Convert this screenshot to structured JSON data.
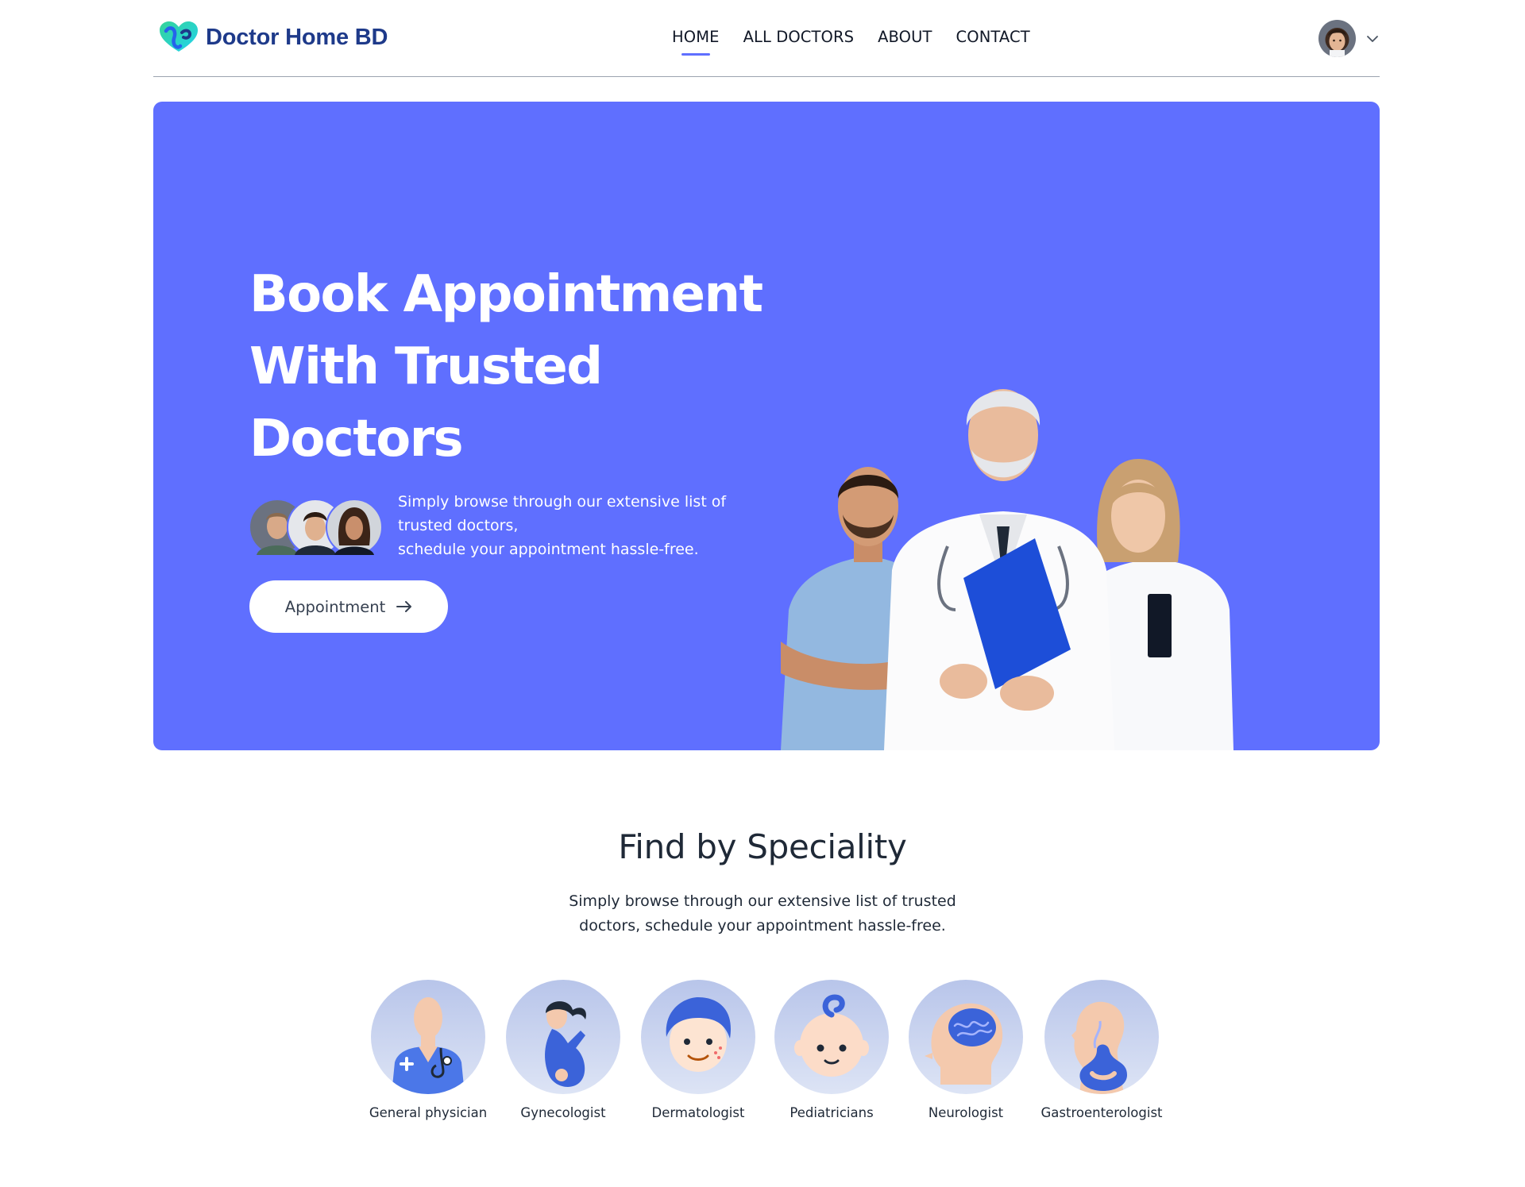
{
  "brand": {
    "name": "Doctor Home BD",
    "accent": "#5f6fff",
    "brand_text_color": "#1e3a8a"
  },
  "nav": {
    "links": [
      "HOME",
      "ALL DOCTORS",
      "ABOUT",
      "CONTACT"
    ],
    "active": "HOME"
  },
  "profile": {
    "avatar_icon": "user-avatar",
    "menu_icon": "chevron-down-icon"
  },
  "hero": {
    "title_lines": [
      "Book Appointment",
      "With Trusted",
      "Doctors"
    ],
    "subtitle_lines": [
      "Simply browse through our extensive list of",
      "trusted doctors,",
      "schedule your appointment hassle-free."
    ],
    "button_label": "Appointment",
    "background": "#5f6fff"
  },
  "speciality": {
    "title": "Find by Speciality",
    "subtitle_lines": [
      "Simply browse through our extensive list of trusted",
      "doctors, schedule your appointment hassle-free."
    ],
    "items": [
      {
        "label": "General physician",
        "icon": "general-physician-icon"
      },
      {
        "label": "Gynecologist",
        "icon": "gynecologist-icon"
      },
      {
        "label": "Dermatologist",
        "icon": "dermatologist-icon"
      },
      {
        "label": "Pediatricians",
        "icon": "pediatrician-icon"
      },
      {
        "label": "Neurologist",
        "icon": "neurologist-icon"
      },
      {
        "label": "Gastroenterologist",
        "icon": "gastroenterologist-icon"
      }
    ]
  }
}
